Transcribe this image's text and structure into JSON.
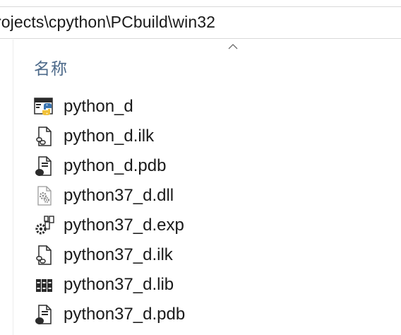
{
  "address_bar": {
    "path": "rojects\\cpython\\PCbuild\\win32"
  },
  "column_header": {
    "name_label": "名称"
  },
  "files": [
    {
      "name": "python_d",
      "icon": "python-exe-icon"
    },
    {
      "name": "python_d.ilk",
      "icon": "ilk-file-icon"
    },
    {
      "name": "python_d.pdb",
      "icon": "pdb-file-icon"
    },
    {
      "name": "python37_d.dll",
      "icon": "dll-file-icon"
    },
    {
      "name": "python37_d.exp",
      "icon": "exp-file-icon"
    },
    {
      "name": "python37_d.ilk",
      "icon": "ilk-file-icon"
    },
    {
      "name": "python37_d.lib",
      "icon": "lib-file-icon"
    },
    {
      "name": "python37_d.pdb",
      "icon": "pdb-file-icon"
    }
  ]
}
